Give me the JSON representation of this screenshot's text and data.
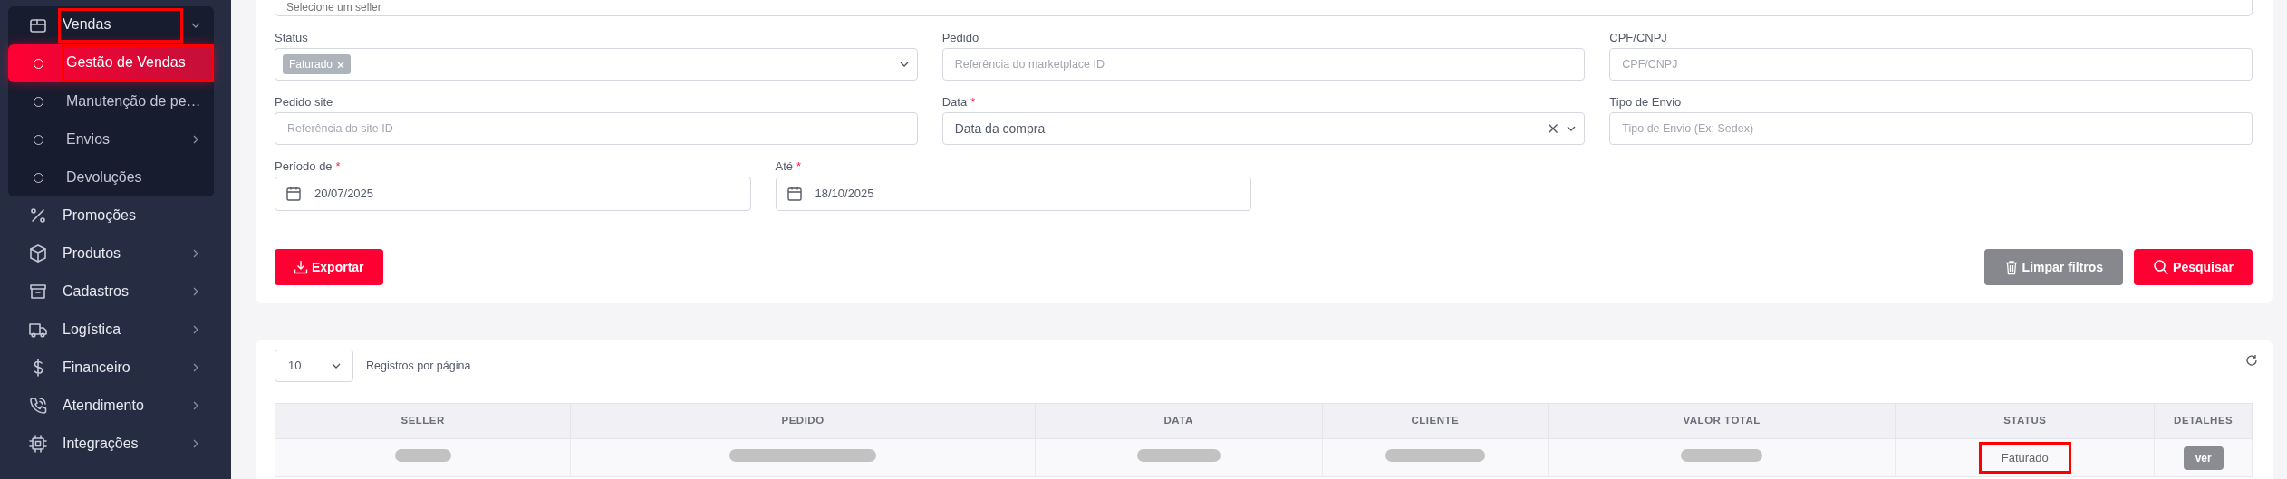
{
  "sidebar": {
    "items": [
      {
        "label": "Vendas",
        "expanded": true,
        "highlighted": true,
        "has_submenu": true,
        "children": [
          {
            "label": "Gestão de Vendas",
            "selected": true,
            "highlighted": true,
            "has_submenu": false
          },
          {
            "label": "Manutenção de pe…",
            "selected": false,
            "highlighted": false,
            "has_submenu": false
          },
          {
            "label": "Envios",
            "selected": false,
            "highlighted": false,
            "has_submenu": true
          },
          {
            "label": "Devoluções",
            "selected": false,
            "highlighted": false,
            "has_submenu": false
          }
        ]
      },
      {
        "label": "Promoções",
        "has_submenu": false
      },
      {
        "label": "Produtos",
        "has_submenu": true
      },
      {
        "label": "Cadastros",
        "has_submenu": true
      },
      {
        "label": "Logística",
        "has_submenu": true
      },
      {
        "label": "Financeiro",
        "has_submenu": true
      },
      {
        "label": "Atendimento",
        "has_submenu": true
      },
      {
        "label": "Integrações",
        "has_submenu": true
      }
    ]
  },
  "filters": {
    "seller_select": {
      "placeholder": "Selecione um seller"
    },
    "rows": [
      [
        {
          "kind": "multiselect",
          "label": "Status",
          "tags": [
            "Faturado"
          ]
        },
        {
          "kind": "text",
          "label": "Pedido",
          "placeholder": "Referência do marketplace ID"
        },
        {
          "kind": "text",
          "label": "CPF/CNPJ",
          "placeholder": "CPF/CNPJ"
        }
      ],
      [
        {
          "kind": "text",
          "label": "Pedido site",
          "placeholder": "Referência do site ID"
        },
        {
          "kind": "select",
          "label": "Data",
          "required_mark": "*",
          "value": "Data da compra"
        },
        {
          "kind": "text",
          "label": "Tipo de Envio",
          "placeholder": "Tipo de Envio (Ex: Sedex)"
        }
      ],
      [
        {
          "kind": "date",
          "label": "Período de",
          "required_mark": "*",
          "value": "20/07/2025"
        },
        {
          "kind": "date",
          "label": "Até",
          "required_mark": "*",
          "value": "18/10/2025"
        }
      ]
    ],
    "buttons": [
      {
        "kind": "export",
        "label": "Exportar"
      },
      {
        "kind": "clear",
        "label": "Limpar filtros"
      },
      {
        "kind": "search",
        "label": "Pesquisar"
      }
    ]
  },
  "results": {
    "page_size": "10",
    "page_size_label": "Registros por página",
    "table": {
      "columns": [
        "SELLER",
        "PEDIDO",
        "DATA",
        "CLIENTE",
        "VALOR TOTAL",
        "STATUS",
        "DETALHES"
      ],
      "rows": [
        {
          "cells": [
            {
              "kind": "redacted"
            },
            {
              "kind": "redacted"
            },
            {
              "kind": "redacted"
            },
            {
              "kind": "redacted"
            },
            {
              "kind": "redacted"
            },
            {
              "kind": "text",
              "text": "Faturado",
              "highlighted": true
            },
            {
              "kind": "button",
              "text": "ver"
            }
          ]
        }
      ]
    }
  }
}
